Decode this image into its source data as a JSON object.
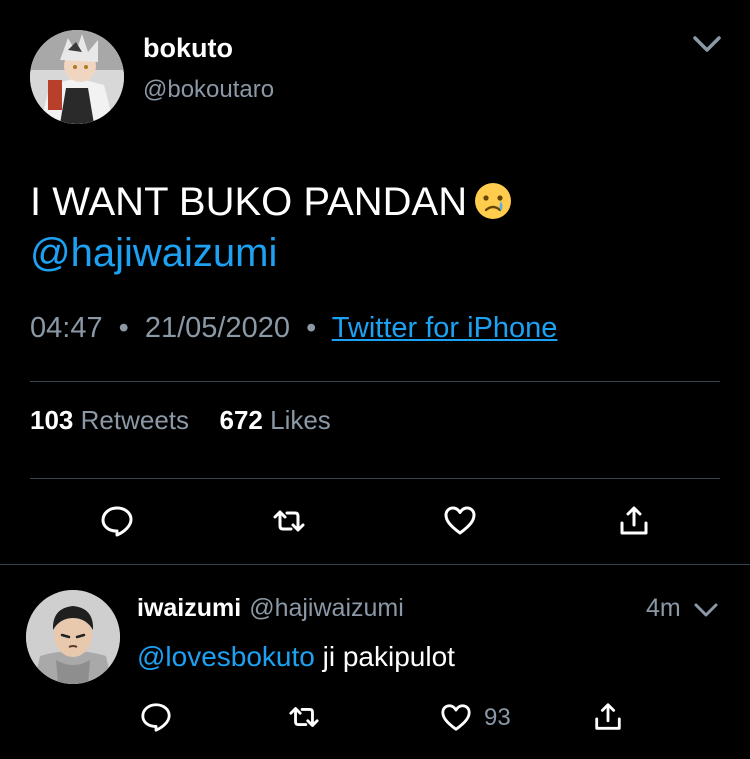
{
  "tweet": {
    "display_name": "bokuto",
    "handle": "@bokoutaro",
    "text_line1": "I WANT BUKO PANDAN",
    "emoji": "crying-face-emoji",
    "mention": "@hajiwaizumi",
    "time": "04:47",
    "separator": "•",
    "date": "21/05/2020",
    "source": "Twitter for iPhone",
    "retweets_count": "103",
    "retweets_label": "Retweets",
    "likes_count": "672",
    "likes_label": "Likes"
  },
  "reply": {
    "display_name": "iwaizumi",
    "handle": "@hajiwaizumi",
    "time": "4m",
    "mention": "@lovesbokuto",
    "text": " ji pakipulot",
    "like_count": "93"
  },
  "colors": {
    "background": "#000000",
    "accent": "#1da1f2",
    "secondary_text": "#8b98a5",
    "divider": "#38444d"
  }
}
